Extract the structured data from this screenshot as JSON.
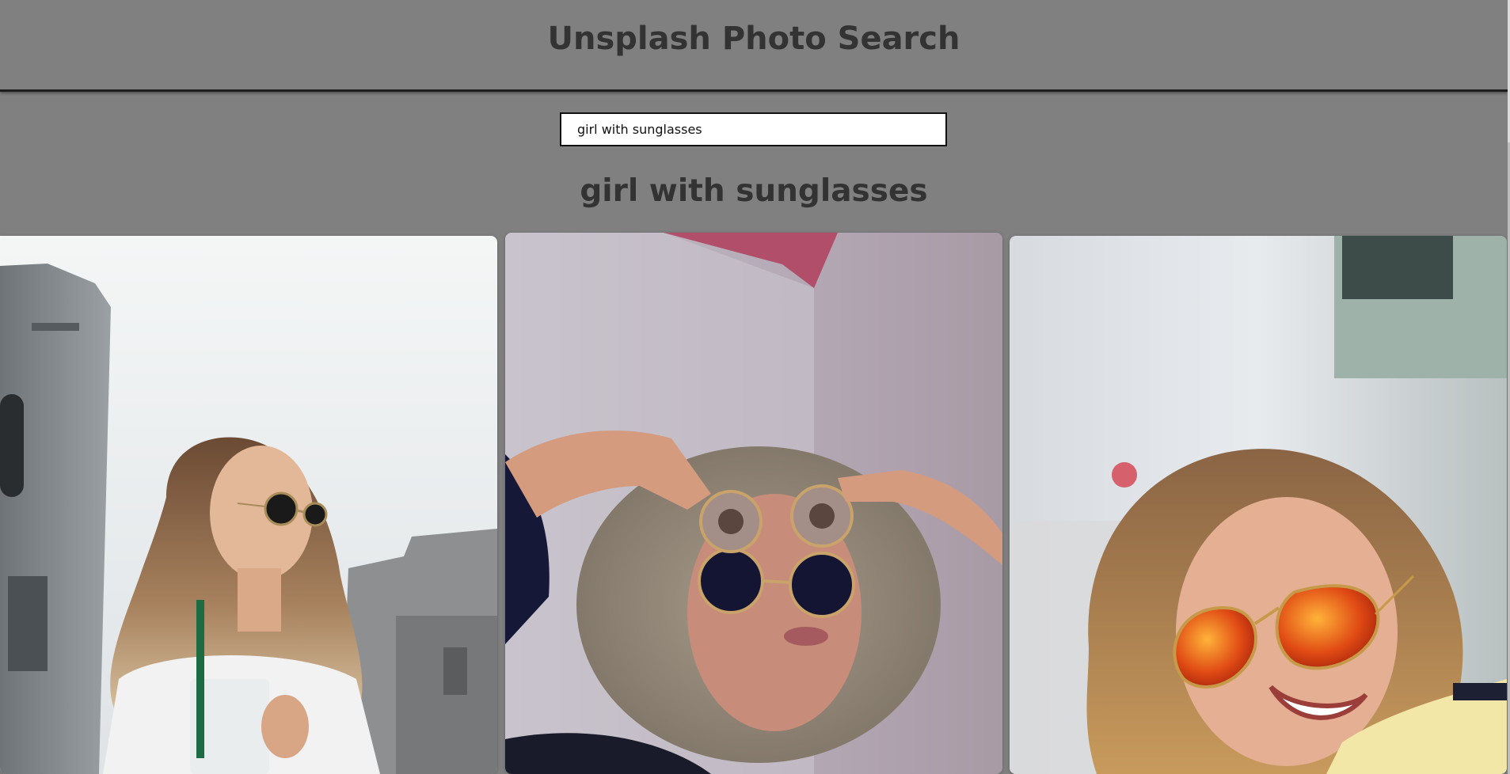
{
  "header": {
    "title": "Unsplash Photo Search"
  },
  "search": {
    "value": "girl with sunglasses",
    "placeholder": ""
  },
  "results": {
    "heading": "girl with sunglasses",
    "photos": [
      {
        "subject": "woman in aviator sunglasses holding iced drink"
      },
      {
        "subject": "woman with curly hair wearing layered round sunglasses"
      },
      {
        "subject": "smiling woman in orange mirrored aviator sunglasses"
      }
    ]
  },
  "colors": {
    "page_background": "#808080",
    "title_text": "#333333",
    "header_border": "#1e1e1e",
    "input_background": "#ffffff",
    "input_border": "#111111"
  }
}
